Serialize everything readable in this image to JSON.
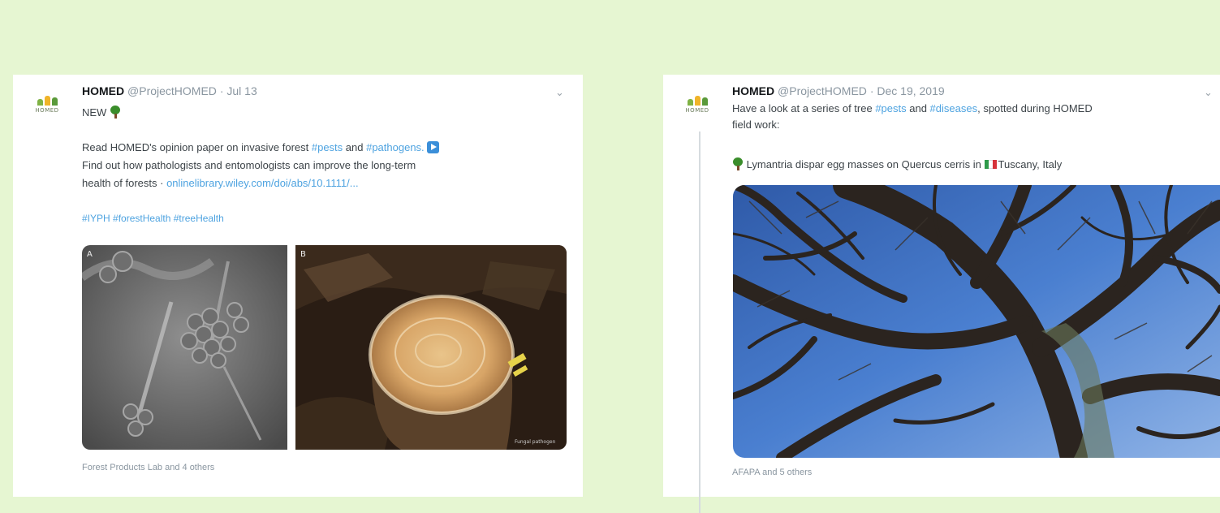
{
  "tweets": [
    {
      "avatar_text": "HOMED",
      "name": "HOMED",
      "handle": "@ProjectHOMED",
      "separator": "·",
      "date": "Jul 13",
      "first_line": "NEW",
      "body_lines": [
        {
          "prefix": "Read HOMED's opinion paper on invasive forest ",
          "tag1": "#pests",
          "mid": " and ",
          "tag2": "#pathogens."
        },
        {
          "text": "Find out how pathologists and entomologists can improve the long-term"
        },
        {
          "prefix": "health of forests · ",
          "link": "onlinelibrary.wiley.com/doi/abs/10.1111/..."
        }
      ],
      "hashtags": "#IYPH #forestHealth #treeHealth",
      "image_labels": {
        "left": "A",
        "right": "B",
        "credit": "Fungal pathogen"
      },
      "footer": "Forest Products Lab and 4 others"
    },
    {
      "avatar_text": "HOMED",
      "name": "HOMED",
      "handle": "@ProjectHOMED",
      "separator": "·",
      "date": "Dec 19, 2019",
      "line1_prefix": "Have a look at a series of tree ",
      "line1_tag1": "#pests",
      "line1_mid": " and ",
      "line1_tag2": "#diseases",
      "line1_suffix": ", spotted during HOMED",
      "line2": "field work:",
      "caption_text": "Lymantria dispar egg masses on Quercus cerris in",
      "caption_place": "Tuscany, Italy",
      "footer": "AFAPA and 5 others"
    }
  ],
  "colors": {
    "background": "#e6f6d2",
    "card": "#ffffff",
    "hashtag": "#4ea3e0",
    "muted": "#8a96a0"
  },
  "icons": [
    "deciduous-tree-icon",
    "play-button-icon",
    "italy-flag-icon",
    "chevron-down-icon"
  ]
}
